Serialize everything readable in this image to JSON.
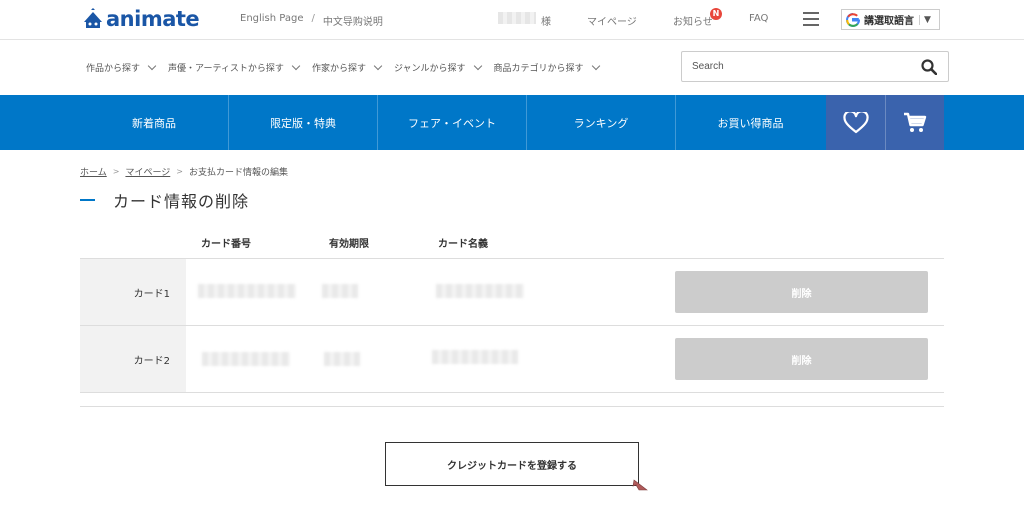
{
  "brand": {
    "logo_text": "animate"
  },
  "topbar": {
    "english_page": "English Page",
    "separator": "/",
    "chinese_help": "中文导购说明",
    "honorific": "様",
    "mypage": "マイページ",
    "notifications": "お知らせ",
    "notification_badge": "N",
    "faq": "FAQ",
    "translate_label": "講選取語言",
    "translate_arrow": "▼"
  },
  "categories": [
    "作品から探す",
    "声優・アーティストから探す",
    "作家から探す",
    "ジャンルから探す",
    "商品カテゴリから探す"
  ],
  "search": {
    "placeholder": "Search"
  },
  "nav": {
    "items": [
      "新着商品",
      "限定版・特典",
      "フェア・イベント",
      "ランキング",
      "お買い得商品"
    ]
  },
  "breadcrumb": {
    "home": "ホーム",
    "mypage": "マイページ",
    "current": "お支払カード情報の編集",
    "separator": ">"
  },
  "page": {
    "title": "カード情報の削除"
  },
  "table": {
    "headers": [
      "カード番号",
      "有効期限",
      "カード名義"
    ],
    "rows": [
      {
        "label": "カード1",
        "delete_label": "削除"
      },
      {
        "label": "カード2",
        "delete_label": "削除"
      }
    ]
  },
  "register_button": "クレジットカードを登録する",
  "colors": {
    "brand_blue": "#0077c8",
    "icon_block": "#3a63ad",
    "disabled_button": "#cccccc",
    "badge_red": "#e8463b"
  }
}
